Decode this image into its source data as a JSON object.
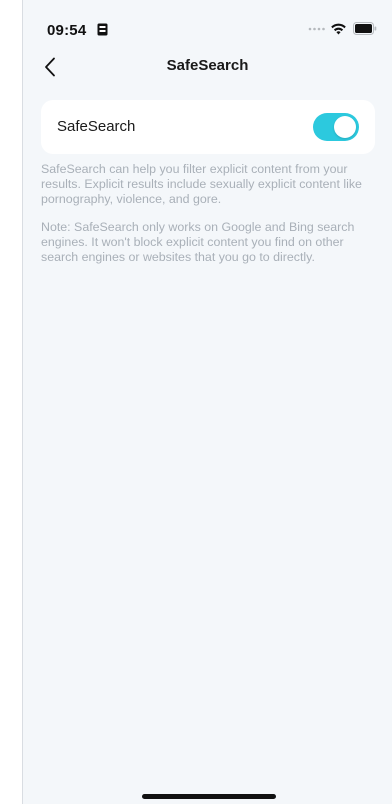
{
  "status_bar": {
    "time": "09:54",
    "icons": [
      "id-card-icon",
      "signal-dots-icon",
      "wifi-icon",
      "battery-icon"
    ]
  },
  "nav": {
    "back_icon": "chevron-left-icon",
    "title": "SafeSearch"
  },
  "setting": {
    "label": "SafeSearch",
    "toggle_on": true,
    "toggle_color": "#2cc9de"
  },
  "descriptions": {
    "info": "SafeSearch can help you filter explicit content from your results. Explicit results include sexually explicit content like pornography, violence, and gore.",
    "note": "Note: SafeSearch only works on Google and Bing search engines. It won't block explicit content you find on other search engines or websites that you go to directly."
  },
  "colors": {
    "background": "#f4f7fa",
    "card": "#ffffff",
    "description_text": "#a9b0b8"
  }
}
